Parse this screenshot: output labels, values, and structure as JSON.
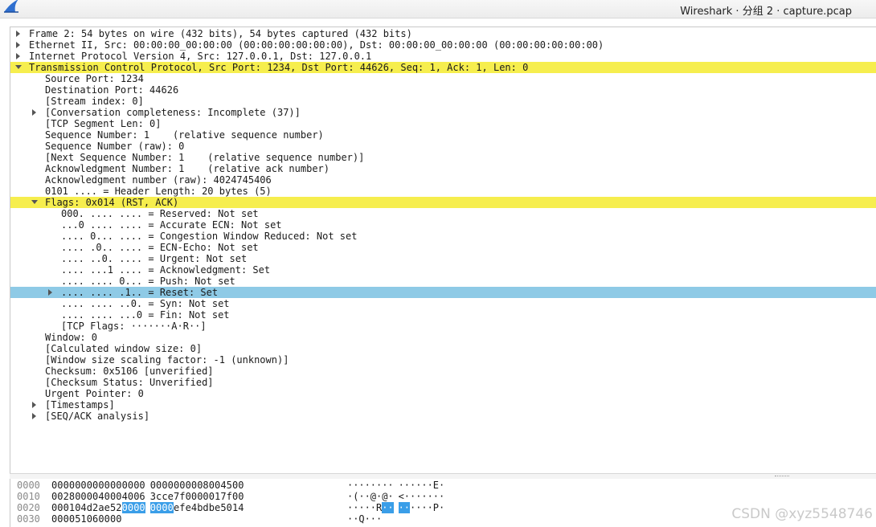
{
  "window": {
    "title": "Wireshark · 分组 2 · capture.pcap",
    "logo_icon": "wireshark-fin-icon",
    "accent": "#2f6fcf"
  },
  "colors": {
    "highlight_yellow": "#f6ee4e",
    "selected_blue": "#8ecae6",
    "hex_selection": "#3a9ee8"
  },
  "tree": [
    {
      "level": 0,
      "expander": "collapsed",
      "text": "Frame 2: 54 bytes on wire (432 bits), 54 bytes captured (432 bits)"
    },
    {
      "level": 0,
      "expander": "collapsed",
      "text": "Ethernet II, Src: 00:00:00_00:00:00 (00:00:00:00:00:00), Dst: 00:00:00_00:00:00 (00:00:00:00:00:00)"
    },
    {
      "level": 0,
      "expander": "collapsed",
      "text": "Internet Protocol Version 4, Src: 127.0.0.1, Dst: 127.0.0.1"
    },
    {
      "level": 0,
      "expander": "expanded",
      "highlight": "yellow",
      "text": "Transmission Control Protocol, Src Port: 1234, Dst Port: 44626, Seq: 1, Ack: 1, Len: 0"
    },
    {
      "level": 1,
      "expander": "none",
      "text": "Source Port: 1234"
    },
    {
      "level": 1,
      "expander": "none",
      "text": "Destination Port: 44626"
    },
    {
      "level": 1,
      "expander": "none",
      "text": "[Stream index: 0]"
    },
    {
      "level": 1,
      "expander": "collapsed",
      "text": "[Conversation completeness: Incomplete (37)]"
    },
    {
      "level": 1,
      "expander": "none",
      "text": "[TCP Segment Len: 0]"
    },
    {
      "level": 1,
      "expander": "none",
      "text": "Sequence Number: 1    (relative sequence number)"
    },
    {
      "level": 1,
      "expander": "none",
      "text": "Sequence Number (raw): 0"
    },
    {
      "level": 1,
      "expander": "none",
      "text": "[Next Sequence Number: 1    (relative sequence number)]"
    },
    {
      "level": 1,
      "expander": "none",
      "text": "Acknowledgment Number: 1    (relative ack number)"
    },
    {
      "level": 1,
      "expander": "none",
      "text": "Acknowledgment number (raw): 4024745406"
    },
    {
      "level": 1,
      "expander": "none",
      "text": "0101 .... = Header Length: 20 bytes (5)"
    },
    {
      "level": 1,
      "expander": "expanded",
      "highlight": "yellow",
      "text": "Flags: 0x014 (RST, ACK)"
    },
    {
      "level": 2,
      "expander": "none",
      "text": "000. .... .... = Reserved: Not set"
    },
    {
      "level": 2,
      "expander": "none",
      "text": "...0 .... .... = Accurate ECN: Not set"
    },
    {
      "level": 2,
      "expander": "none",
      "text": ".... 0... .... = Congestion Window Reduced: Not set"
    },
    {
      "level": 2,
      "expander": "none",
      "text": ".... .0.. .... = ECN-Echo: Not set"
    },
    {
      "level": 2,
      "expander": "none",
      "text": ".... ..0. .... = Urgent: Not set"
    },
    {
      "level": 2,
      "expander": "none",
      "text": ".... ...1 .... = Acknowledgment: Set"
    },
    {
      "level": 2,
      "expander": "none",
      "text": ".... .... 0... = Push: Not set"
    },
    {
      "level": 2,
      "expander": "collapsed",
      "highlight": "blue",
      "text": ".... .... .1.. = Reset: Set"
    },
    {
      "level": 2,
      "expander": "none",
      "text": ".... .... ..0. = Syn: Not set"
    },
    {
      "level": 2,
      "expander": "none",
      "text": ".... .... ...0 = Fin: Not set"
    },
    {
      "level": 2,
      "expander": "none",
      "text": "[TCP Flags: ·······A·R··]"
    },
    {
      "level": 1,
      "expander": "none",
      "text": "Window: 0"
    },
    {
      "level": 1,
      "expander": "none",
      "text": "[Calculated window size: 0]"
    },
    {
      "level": 1,
      "expander": "none",
      "text": "[Window size scaling factor: -1 (unknown)]"
    },
    {
      "level": 1,
      "expander": "none",
      "text": "Checksum: 0x5106 [unverified]"
    },
    {
      "level": 1,
      "expander": "none",
      "text": "[Checksum Status: Unverified]"
    },
    {
      "level": 1,
      "expander": "none",
      "text": "Urgent Pointer: 0"
    },
    {
      "level": 1,
      "expander": "collapsed",
      "text": "[Timestamps]"
    },
    {
      "level": 1,
      "expander": "collapsed",
      "text": "[SEQ/ACK analysis]"
    }
  ],
  "hex_dump": [
    {
      "offset": "0000",
      "bytes": [
        "00",
        "00",
        "00",
        "00",
        "00",
        "00",
        "00",
        "00",
        "00",
        "00",
        "00",
        "00",
        "08",
        "00",
        "45",
        "00"
      ],
      "ascii": [
        "·",
        "·",
        "·",
        "·",
        "·",
        "·",
        "·",
        "·",
        "·",
        "·",
        "·",
        "·",
        "·",
        "·",
        "E",
        "·"
      ],
      "selected": []
    },
    {
      "offset": "0010",
      "bytes": [
        "00",
        "28",
        "00",
        "00",
        "40",
        "00",
        "40",
        "06",
        "3c",
        "ce",
        "7f",
        "00",
        "00",
        "01",
        "7f",
        "00"
      ],
      "ascii": [
        "·",
        "(",
        "·",
        "·",
        "@",
        "·",
        "@",
        "·",
        "<",
        "·",
        "·",
        "·",
        "·",
        "·",
        "·",
        "·"
      ],
      "selected": []
    },
    {
      "offset": "0020",
      "bytes": [
        "00",
        "01",
        "04",
        "d2",
        "ae",
        "52",
        "00",
        "00",
        "00",
        "00",
        "ef",
        "e4",
        "bd",
        "be",
        "50",
        "14"
      ],
      "ascii": [
        "·",
        "·",
        "·",
        "·",
        "·",
        "R",
        "·",
        "·",
        "·",
        "·",
        "·",
        "·",
        "·",
        "·",
        "P",
        "·"
      ],
      "selected": [
        6,
        7,
        8,
        9
      ]
    },
    {
      "offset": "0030",
      "bytes": [
        "00",
        "00",
        "51",
        "06",
        "00",
        "00"
      ],
      "ascii": [
        "·",
        "·",
        "Q",
        "·",
        "·",
        "·"
      ],
      "selected": []
    }
  ],
  "watermark": "CSDN @xyz5548746"
}
